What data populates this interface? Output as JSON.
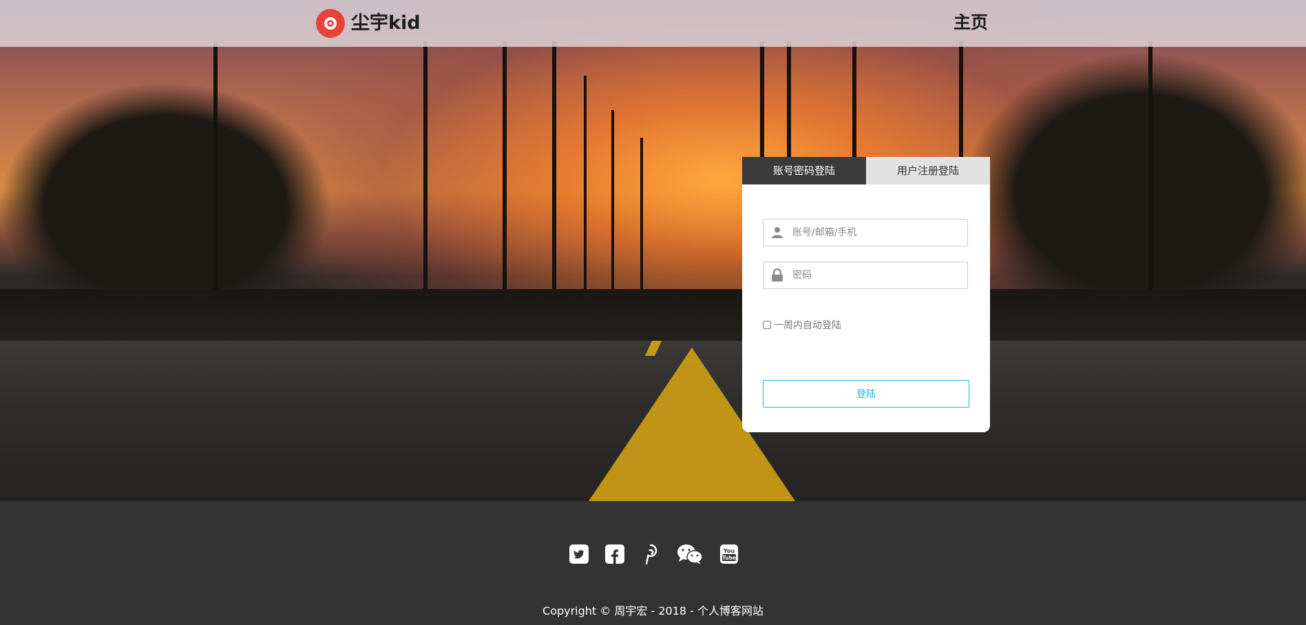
{
  "brand": {
    "logo_text": "尘宇kid",
    "accent": "#e5423a"
  },
  "nav": {
    "home_label": "主页"
  },
  "login": {
    "tabs": [
      {
        "label": "账号密码登陆",
        "active": true
      },
      {
        "label": "用户注册登陆",
        "active": false
      }
    ],
    "username_placeholder": "账号/邮箱/手机",
    "password_placeholder": "密码",
    "remember_label": "一周内自动登陆",
    "submit_label": "登陆",
    "button_color": "#1db5e0"
  },
  "footer": {
    "social_icons": [
      "twitter-icon",
      "facebook-icon",
      "pinterest-icon",
      "wechat-icon",
      "youtube-icon"
    ],
    "copyright": "Copyright © 周宇宏 - 2018 - 个人博客网站"
  }
}
